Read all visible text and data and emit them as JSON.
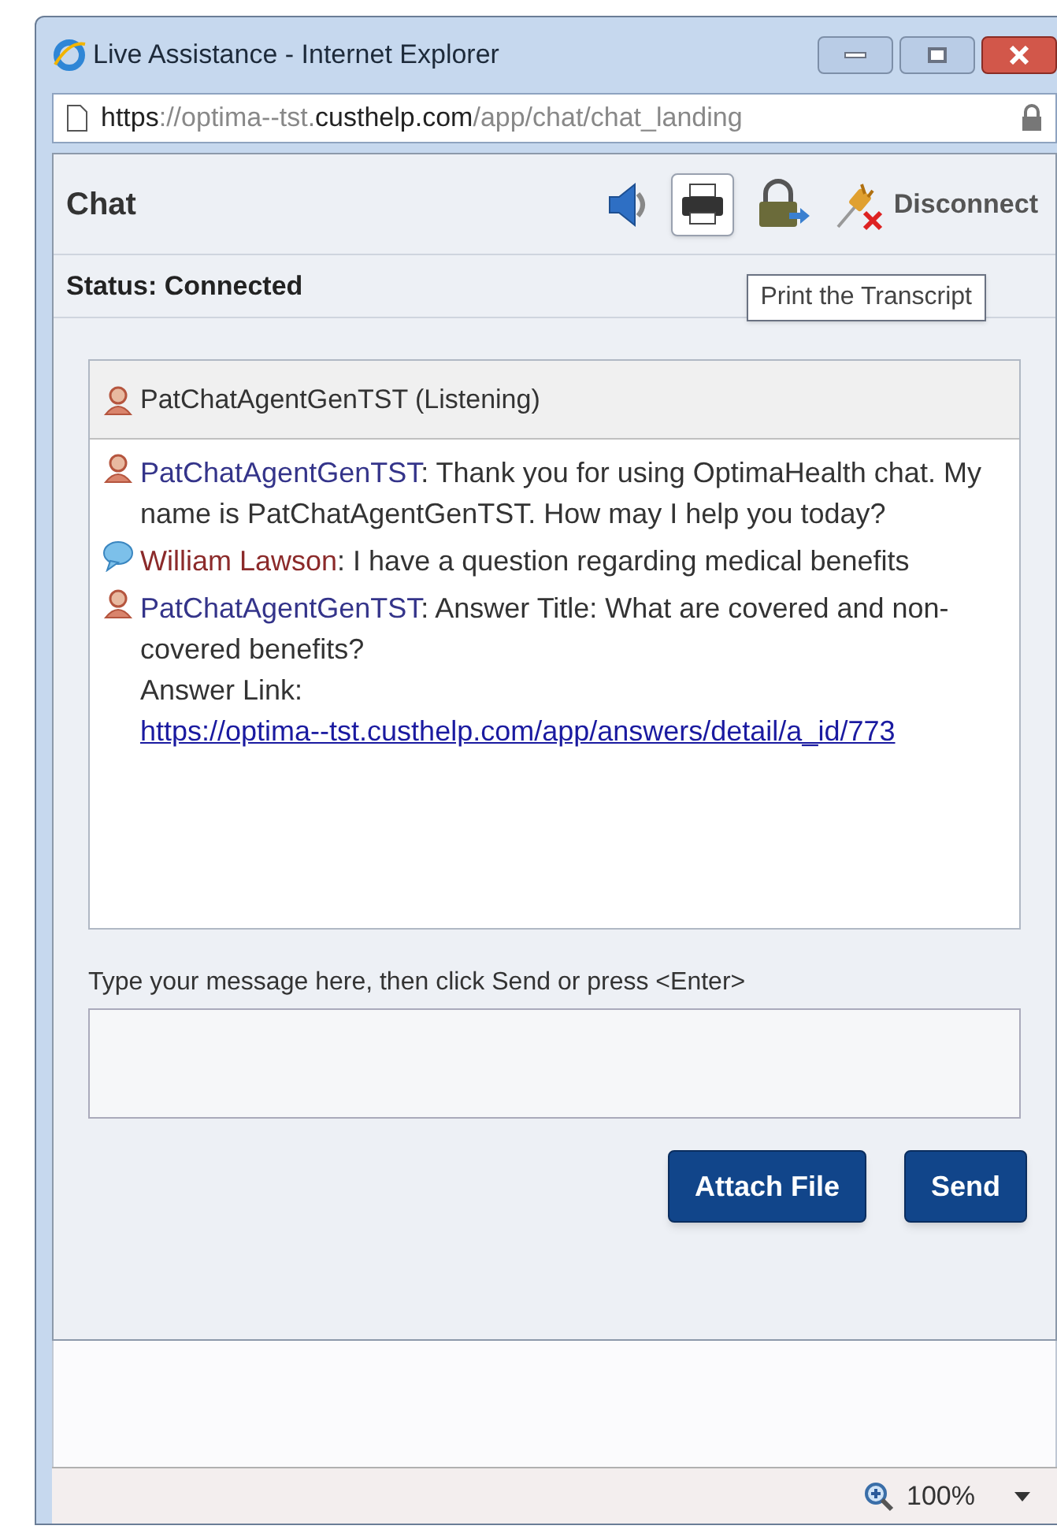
{
  "window": {
    "title": "Live Assistance - Internet Explorer",
    "address": {
      "scheme": "https",
      "rest_pre": "://optima--tst.",
      "domain": "custhelp.com",
      "path": "/app/chat/chat_landing"
    }
  },
  "chat": {
    "title": "Chat",
    "toolbar": [
      {
        "kind": "sound",
        "hovered": false
      },
      {
        "kind": "print",
        "hovered": true
      },
      {
        "kind": "secure",
        "hovered": false
      },
      {
        "kind": "disconnect",
        "label": "Disconnect",
        "hovered": false
      }
    ],
    "tooltip": "Print the Transcript",
    "status": "Status: Connected",
    "participant": {
      "kind": "agent",
      "label": "PatChatAgentGenTST (Listening)"
    },
    "messages": [
      {
        "kind": "agent",
        "name": "PatChatAgentGenTST",
        "text": ": Thank you for using OptimaHealth chat. My name is PatChatAgentGenTST. How may I help you today?"
      },
      {
        "kind": "user",
        "name": "William Lawson",
        "text": ": I have a question regarding medical benefits"
      },
      {
        "kind": "agent",
        "name": "PatChatAgentGenTST",
        "text": ": Answer Title: What are covered and non-covered benefits?",
        "link_label": "Answer Link: ",
        "link": "https://optima--tst.custhelp.com/app/answers/detail/a_id/773"
      }
    ],
    "input": {
      "label": "Type your message here, then click Send or press <Enter>"
    },
    "buttons": [
      "Attach File",
      "Send"
    ]
  },
  "status_bar": {
    "zoom": "100%"
  }
}
